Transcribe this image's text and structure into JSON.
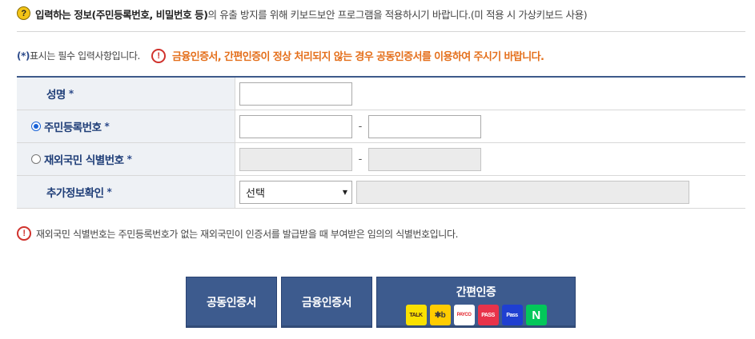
{
  "notice": {
    "icon": "question-icon",
    "bold_text": "입력하는 정보(주민등록번호, 비밀번호 등)",
    "rest_text": "의 유출 방지를 위해 키보드보안 프로그램을 적용하시기 바랍니다.(미 적용 시 가상키보드 사용)"
  },
  "legend": {
    "star": "(*)",
    "text": " 표시는 필수 입력사항입니다.",
    "warning": "금융인증서, 간편인증이 정상 처리되지 않는 경우 공동인증서를 이용하여 주시기 바랍니다."
  },
  "form": {
    "name_label": "성명",
    "rrn_label": "주민등록번호",
    "foreign_label": "재외국민 식별번호",
    "extra_label": "추가정보확인",
    "required_mark": "*",
    "dash": "-",
    "select_value": "선택",
    "rrn_selected": true,
    "foreign_selected": false
  },
  "info": {
    "text": "재외국민 식별번호는 주민등록번호가 없는 재외국민이 인증서를 발급받을 때 부여받은 임의의 식별번호입니다."
  },
  "buttons": {
    "joint_cert": "공동인증서",
    "financial_cert": "금융인증서",
    "simple_auth": "간편인증"
  },
  "simple_auth_providers": [
    {
      "name": "kakao",
      "label": "TALK"
    },
    {
      "name": "kb",
      "label": "✱b"
    },
    {
      "name": "payco",
      "label": "PAYCO"
    },
    {
      "name": "pass",
      "label": "PASS"
    },
    {
      "name": "samsung-pass",
      "label": "Pass"
    },
    {
      "name": "naver",
      "label": "N"
    }
  ],
  "colors": {
    "accent_blue": "#3d5b8e",
    "warning_orange": "#e46f1b",
    "warning_red": "#d0322d",
    "label_blue": "#1f3e78"
  }
}
